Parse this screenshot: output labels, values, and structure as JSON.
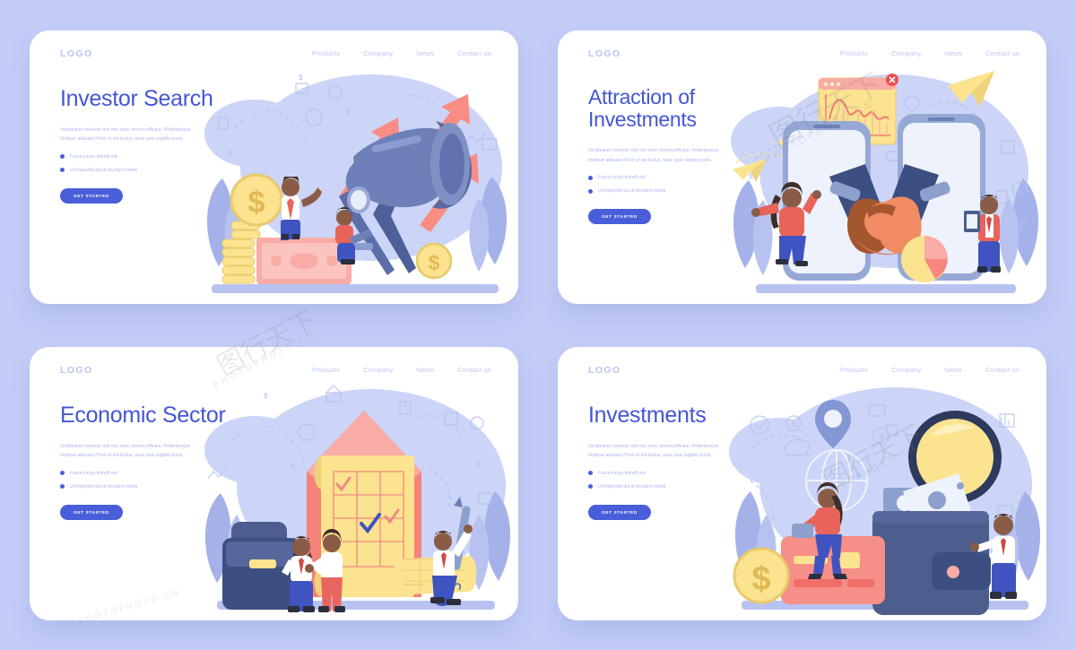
{
  "page": {
    "background_color": "#c4cdf7",
    "card_background": "#ffffff",
    "accent_color": "#4a5ed9",
    "headline_color": "#4356d6",
    "muted_text_color": "#aab6ee",
    "logo_color": "#b9c3f2",
    "coral_color": "#f98d83",
    "yellow_color": "#fbe38f",
    "navy_color": "#4d5d8e"
  },
  "shared": {
    "logo": "LOGO",
    "nav": [
      {
        "label": "Products"
      },
      {
        "label": "Company"
      },
      {
        "label": "News"
      },
      {
        "label": "Contact us"
      }
    ],
    "paragraph": "Vestibulum molestie nisl nec nunc viverra efficitur. Pellentesque tristique aliquam.Proin ut est luctus, risus quis sagittis porta.",
    "bullets": [
      "Fusce luctus blandit nisi",
      "Ut imperdiet dui at tincidunt mattis"
    ],
    "cta_label": "GET STARTED"
  },
  "cards": [
    {
      "id": "investor-search",
      "title": "Investor Search",
      "illustration": "telescope-coins-banknote-investors"
    },
    {
      "id": "attraction-of-investments",
      "title": "Attraction of Investments",
      "illustration": "handshake-smartphones-chart-window"
    },
    {
      "id": "economic-sector",
      "title": "Economic Sector",
      "illustration": "document-checklist-briefcase-contract"
    },
    {
      "id": "investments",
      "title": "Investments",
      "illustration": "wallet-credit-card-magnifier-coin"
    }
  ],
  "watermark": {
    "cn_mark": "图行天下",
    "latin_mark": "PHOTOPHOTO.CN"
  }
}
